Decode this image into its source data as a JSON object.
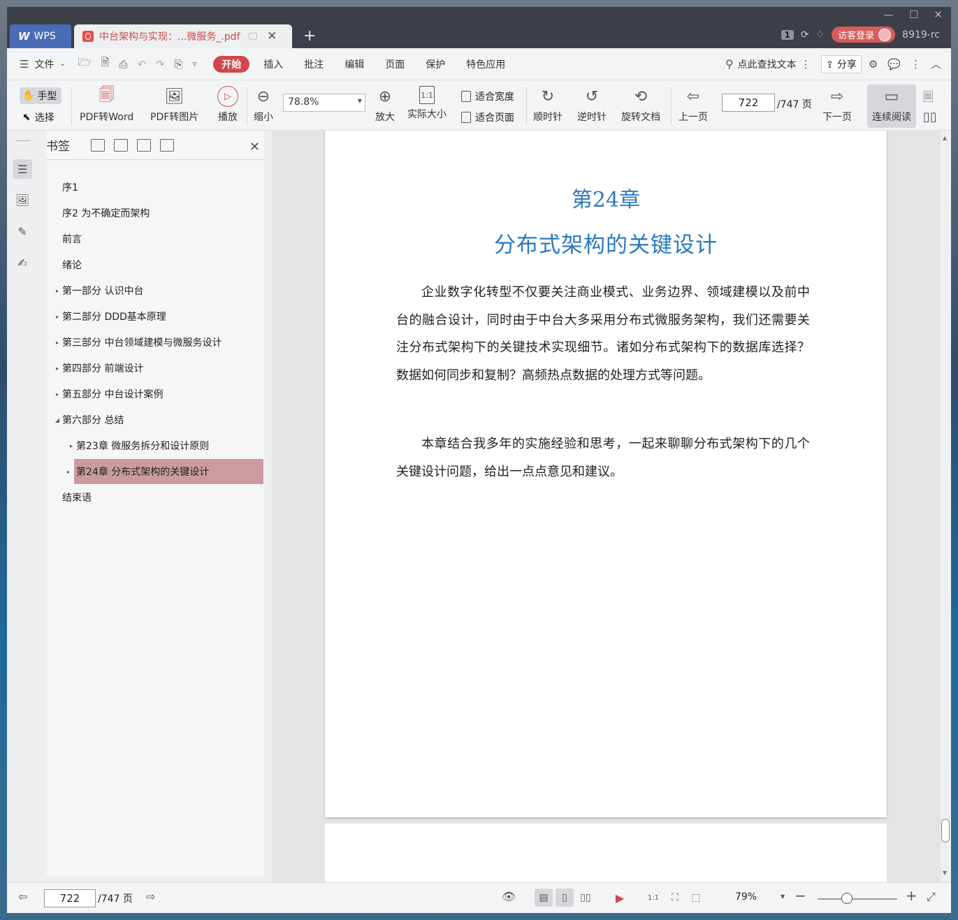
{
  "window": {
    "wps_tab": "WPS",
    "doc_tab": "中台架构与实现：...微服务_.pdf",
    "page_count_badge": "1",
    "login": "访客登录",
    "user": "8919-rc"
  },
  "menu": {
    "file": "文件",
    "items": [
      "开始",
      "插入",
      "批注",
      "编辑",
      "页面",
      "保护",
      "特色应用"
    ],
    "search": "点此查找文本",
    "share": "分享"
  },
  "toolbar": {
    "hand": "手型",
    "select": "选择",
    "pdf_to_word": "PDF转Word",
    "pdf_to_image": "PDF转图片",
    "play": "播放",
    "zoom_out": "缩小",
    "zoom_value": "78.8%",
    "zoom_in": "放大",
    "actual_size": "实际大小",
    "fit_width": "适合宽度",
    "fit_page": "适合页面",
    "clockwise": "顺时针",
    "counter_clockwise": "逆时针",
    "rotate_doc": "旋转文档",
    "prev_page": "上一页",
    "page_value": "722",
    "page_total": "/747 页",
    "next_page": "下一页",
    "continuous": "连续阅读"
  },
  "bookmarks": {
    "title": "书签",
    "items": [
      {
        "label": "序1",
        "arrow": ""
      },
      {
        "label": "序2 为不确定而架构",
        "arrow": ""
      },
      {
        "label": "前言",
        "arrow": ""
      },
      {
        "label": "绪论",
        "arrow": ""
      },
      {
        "label": "第一部分 认识中台",
        "arrow": "▸"
      },
      {
        "label": "第二部分 DDD基本原理",
        "arrow": "▸"
      },
      {
        "label": "第三部分 中台领域建模与微服务设计",
        "arrow": "▸"
      },
      {
        "label": "第四部分 前端设计",
        "arrow": "▸"
      },
      {
        "label": "第五部分 中台设计案例",
        "arrow": "▸"
      },
      {
        "label": "第六部分 总结",
        "arrow": "◢"
      },
      {
        "label": "第23章 微服务拆分和设计原则",
        "arrow": "▸"
      },
      {
        "label": "第24章 分布式架构的关键设计",
        "arrow": "▸"
      },
      {
        "label": "结束语",
        "arrow": ""
      }
    ]
  },
  "document": {
    "chapter": "第24章",
    "chapter_title": "分布式架构的关键设计",
    "para1": "企业数字化转型不仅要关注商业模式、业务边界、领域建模以及前中台的融合设计，同时由于中台大多采用分布式微服务架构，我们还需要关注分布式架构下的关键技术实现细节。诸如分布式架构下的数据库选择？数据如何同步和复制？高频热点数据的处理方式等问题。",
    "para2": "本章结合我多年的实施经验和思考，一起来聊聊分布式架构下的几个关键设计问题，给出一点点意见和建议。"
  },
  "status": {
    "page_value": "722",
    "page_total": "/747 页",
    "zoom": "79%"
  },
  "colors": {
    "accent": "#d14848",
    "chapter_blue": "#2a79bf",
    "selected_bookmark": "#cc9ba2"
  }
}
